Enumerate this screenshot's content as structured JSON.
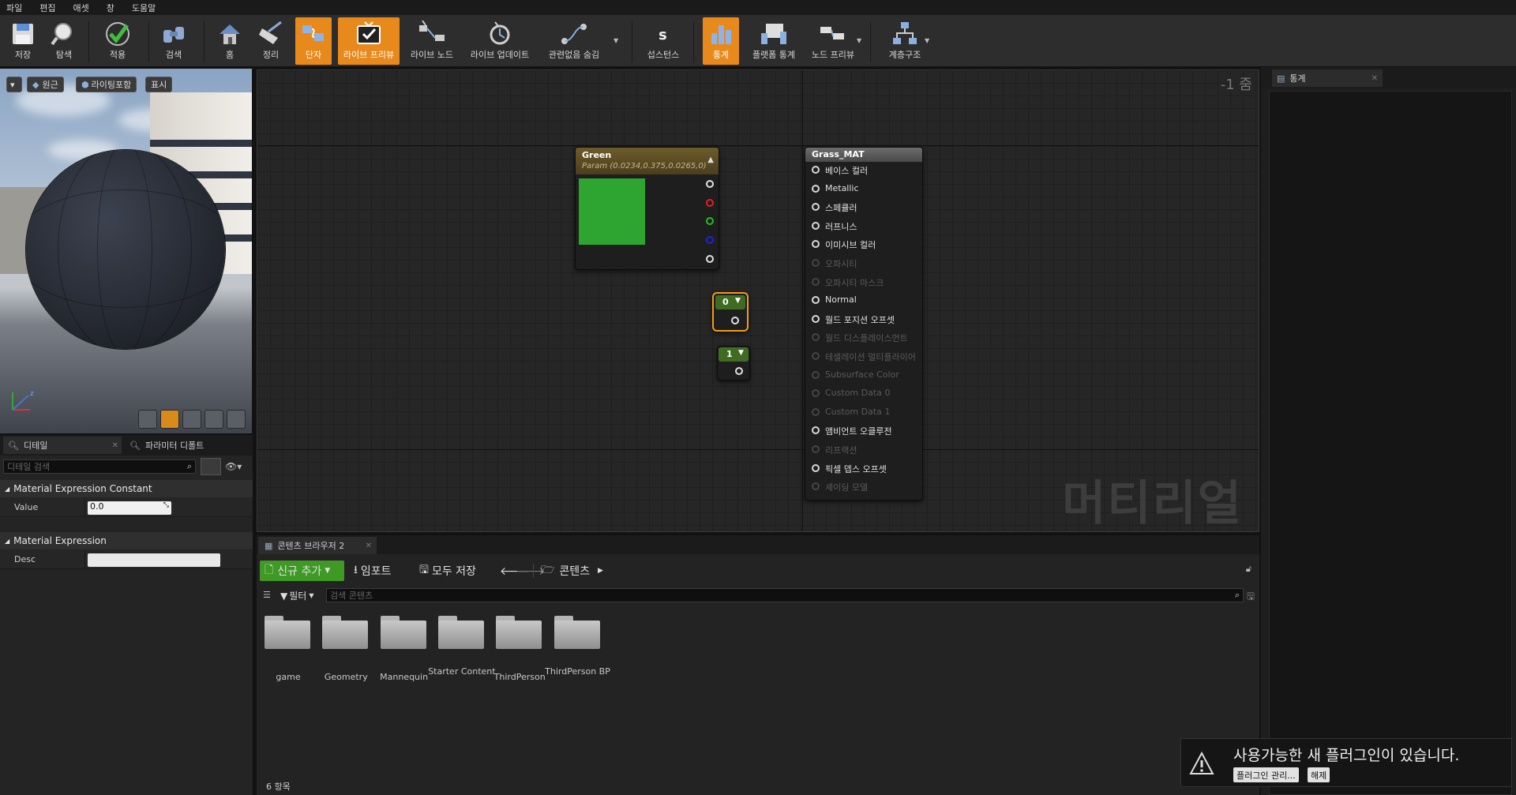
{
  "menu": [
    "파일",
    "편집",
    "애셋",
    "창",
    "도움말"
  ],
  "toolbar": {
    "save": "저장",
    "browse": "탐색",
    "apply": "적용",
    "search": "검색",
    "home": "홈",
    "clean": "정리",
    "connectors": "단자",
    "live_preview": "라이브 프리뷰",
    "live_nodes": "라이브 노드",
    "live_update": "라이브 업데이트",
    "hide_unrelated": "관련없음 숨김",
    "substance": "섭스턴스",
    "stats": "통계",
    "platform_stats": "플랫폼 통계",
    "node_preview": "노드 프리뷰",
    "hierarchy": "계층구조"
  },
  "viewport": {
    "perspective": "원근",
    "lit": "라이팅포함",
    "show": "표시"
  },
  "details": {
    "tab_details": "디테일",
    "tab_params": "파라미터 디폴트",
    "search_placeholder": "디테일 검색",
    "cat1": "Material Expression Constant",
    "value_label": "Value",
    "value": "0.0",
    "cat2": "Material Expression",
    "desc_label": "Desc",
    "desc": ""
  },
  "graph": {
    "zoom": "-1 줌",
    "watermark": "머티리얼",
    "green_node": {
      "title": "Green",
      "subtitle": "Param (0.0234,0.375,0.0265,0)",
      "color": "#2ea531"
    },
    "const0": "0",
    "const1": "1",
    "material": {
      "title": "Grass_MAT",
      "inputs": [
        {
          "label": "베이스 컬러",
          "enabled": true
        },
        {
          "label": "Metallic",
          "enabled": true
        },
        {
          "label": "스페큘러",
          "enabled": true
        },
        {
          "label": "러프니스",
          "enabled": true
        },
        {
          "label": "이미시브 컬러",
          "enabled": true
        },
        {
          "label": "오파시티",
          "enabled": false
        },
        {
          "label": "오파시티 마스크",
          "enabled": false
        },
        {
          "label": "Normal",
          "enabled": true
        },
        {
          "label": "월드 포지션 오프셋",
          "enabled": true
        },
        {
          "label": "월드 디스플레이스먼트",
          "enabled": false
        },
        {
          "label": "테셀레이션 멀티플라이어",
          "enabled": false
        },
        {
          "label": "Subsurface Color",
          "enabled": false
        },
        {
          "label": "Custom Data 0",
          "enabled": false
        },
        {
          "label": "Custom Data 1",
          "enabled": false
        },
        {
          "label": "앰비언트 오클루전",
          "enabled": true
        },
        {
          "label": "리프랙션",
          "enabled": false
        },
        {
          "label": "픽셀 뎁스 오프셋",
          "enabled": true
        },
        {
          "label": "셰이딩 모델",
          "enabled": false
        }
      ]
    }
  },
  "content_browser": {
    "tab": "콘텐츠 브라우저 2",
    "add_new": "신규 추가",
    "import": "임포트",
    "save_all": "모두 저장",
    "path": "콘텐츠",
    "filter": "필터",
    "search_placeholder": "검색 콘텐츠",
    "folders": [
      "game",
      "Geometry",
      "Mannequin",
      "Starter Content",
      "ThirdPerson",
      "ThirdPerson BP"
    ],
    "item_count": "6 항목"
  },
  "stats_panel": {
    "tab": "통계"
  },
  "notification": {
    "message": "사용가능한 새 플러그인이 있습니다.",
    "manage": "플러그인 관리...",
    "dismiss": "해제"
  }
}
